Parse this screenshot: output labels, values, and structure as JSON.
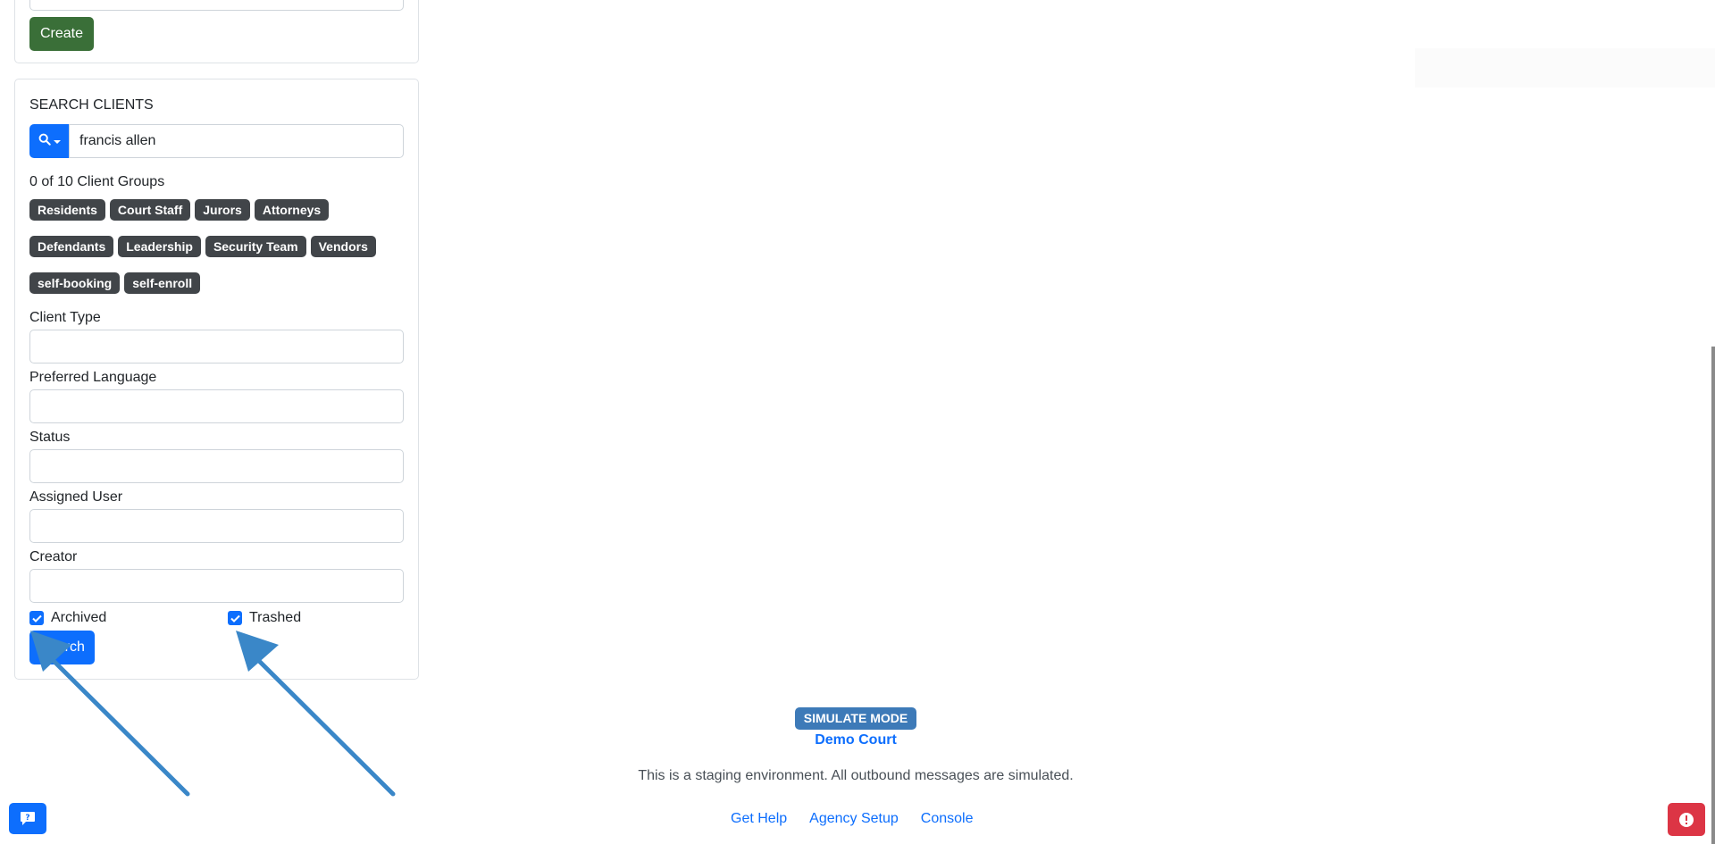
{
  "create": {
    "button_label": "Create"
  },
  "search": {
    "section_title": "SEARCH CLIENTS",
    "query_value": "francis allen",
    "groups_count": "0 of 10 Client Groups",
    "groups": [
      [
        "Residents",
        "Court Staff",
        "Jurors",
        "Attorneys"
      ],
      [
        "Defendants",
        "Leadership",
        "Security Team",
        "Vendors"
      ],
      [
        "self-booking",
        "self-enroll"
      ]
    ],
    "fields": [
      "Client Type",
      "Preferred Language",
      "Status",
      "Assigned User",
      "Creator"
    ],
    "archived_label": "Archived",
    "archived_checked": true,
    "trashed_label": "Trashed",
    "trashed_checked": true,
    "search_button_label": "Search"
  },
  "footer": {
    "mode_badge": "SIMULATE MODE",
    "agency_name": "Demo Court",
    "notice": "This is a staging environment. All outbound messages are simulated.",
    "links": [
      "Get Help",
      "Agency Setup",
      "Console"
    ]
  },
  "colors": {
    "primary": "#0d6efd",
    "create_green": "#3a6f38",
    "badge_dark": "#414549",
    "simulate_blue": "#3d7ab8",
    "alert_red": "#dc3545",
    "annotation_arrow": "#3a87c8"
  },
  "icons": {
    "search_addon": "search-icon",
    "chat": "chat-help-icon",
    "alert": "alert-icon"
  }
}
